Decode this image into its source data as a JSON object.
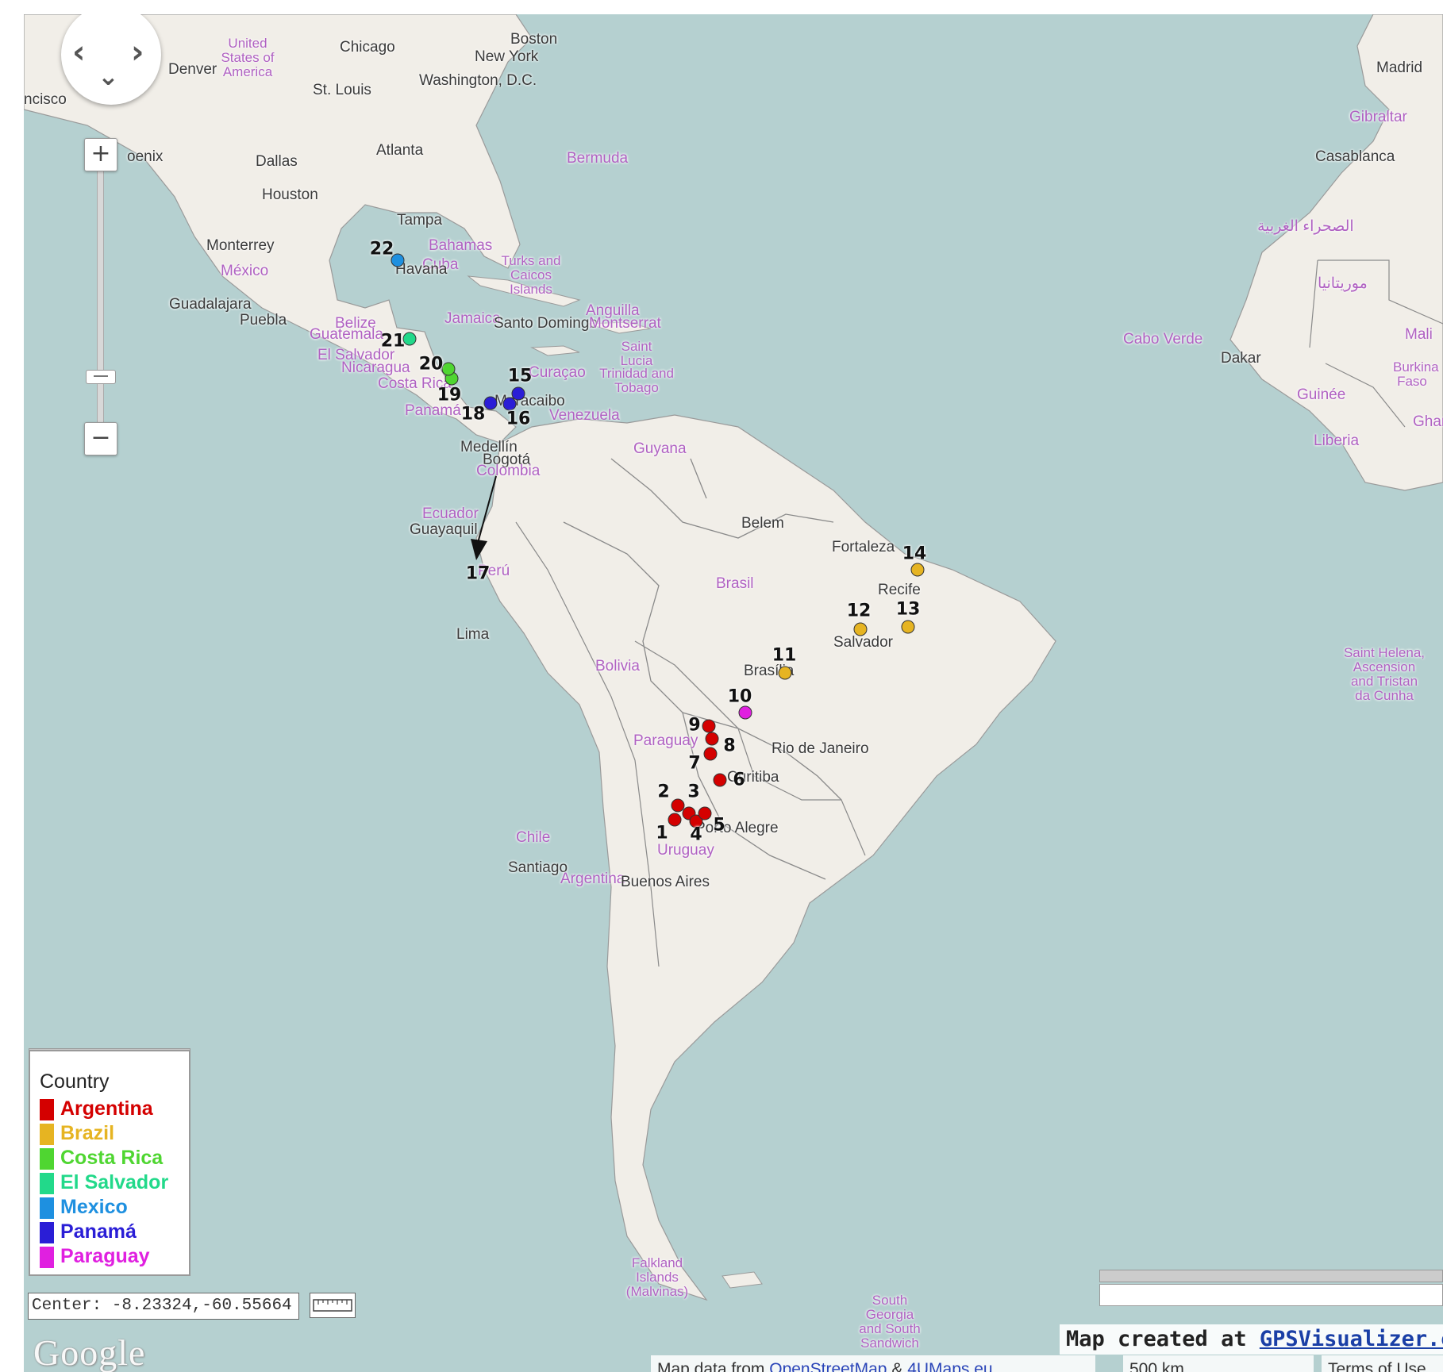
{
  "colors": {
    "water": "#b5d0d0",
    "land": "#f1eee8",
    "border": "#8a8a8a",
    "Argentina": "#d40000",
    "Brazil": "#e6b422",
    "Costa Rica": "#4fd631",
    "El Salvador": "#22d98a",
    "Mexico": "#1e90e0",
    "Panamá": "#2a1ed6",
    "Paraguay": "#e020e0"
  },
  "places": [
    {
      "name": "Chicago",
      "style": "dark"
    },
    {
      "name": "Boston",
      "style": "dark"
    },
    {
      "name": "New York",
      "style": "dark"
    },
    {
      "name": "Washington, D.C.",
      "style": "dark"
    },
    {
      "name": "St. Louis",
      "style": "dark"
    },
    {
      "name": "Denver",
      "style": "dark"
    },
    {
      "name": "United States of America",
      "style": "pink"
    },
    {
      "name": "ncisco",
      "style": "dark"
    },
    {
      "name": "oenix",
      "style": "dark"
    },
    {
      "name": "Dallas",
      "style": "dark"
    },
    {
      "name": "Atlanta",
      "style": "dark"
    },
    {
      "name": "Houston",
      "style": "dark"
    },
    {
      "name": "Tampa",
      "style": "dark"
    },
    {
      "name": "Bahamas",
      "style": "pink"
    },
    {
      "name": "Cuba",
      "style": "pink"
    },
    {
      "name": "Havana",
      "style": "dark"
    },
    {
      "name": "Bermuda",
      "style": "pink"
    },
    {
      "name": "Monterrey",
      "style": "dark"
    },
    {
      "name": "México",
      "style": "pink"
    },
    {
      "name": "Guadalajara",
      "style": "dark"
    },
    {
      "name": "Puebla",
      "style": "dark"
    },
    {
      "name": "Turks and Caicos Islands",
      "style": "pink"
    },
    {
      "name": "Jamaica",
      "style": "pink"
    },
    {
      "name": "Santo Domingo",
      "style": "dark"
    },
    {
      "name": "Anguilla",
      "style": "pink"
    },
    {
      "name": "Montserrat",
      "style": "pink"
    },
    {
      "name": "Belize",
      "style": "pink"
    },
    {
      "name": "Guatemala",
      "style": "pink"
    },
    {
      "name": "El Salvador",
      "style": "pink"
    },
    {
      "name": "Nicaragua",
      "style": "pink"
    },
    {
      "name": "Costa Rica",
      "style": "pink"
    },
    {
      "name": "Panamá",
      "style": "pink"
    },
    {
      "name": "Saint Lucia",
      "style": "pink"
    },
    {
      "name": "Curaçao",
      "style": "pink"
    },
    {
      "name": "Trinidad and Tobago",
      "style": "pink"
    },
    {
      "name": "Maracaibo",
      "style": "dark"
    },
    {
      "name": "Venezuela",
      "style": "pink"
    },
    {
      "name": "Medellín",
      "style": "dark"
    },
    {
      "name": "Bogotá",
      "style": "dark"
    },
    {
      "name": "Colombia",
      "style": "pink"
    },
    {
      "name": "Guyana",
      "style": "pink"
    },
    {
      "name": "Ecuador",
      "style": "pink"
    },
    {
      "name": "Guayaquil",
      "style": "dark"
    },
    {
      "name": "Perú",
      "style": "pink"
    },
    {
      "name": "Lima",
      "style": "dark"
    },
    {
      "name": "Belem",
      "style": "dark"
    },
    {
      "name": "Fortaleza",
      "style": "dark"
    },
    {
      "name": "Recife",
      "style": "dark"
    },
    {
      "name": "Brasil",
      "style": "pink"
    },
    {
      "name": "Salvador",
      "style": "dark"
    },
    {
      "name": "Brasília",
      "style": "dark"
    },
    {
      "name": "Bolivia",
      "style": "pink"
    },
    {
      "name": "Paraguay",
      "style": "pink"
    },
    {
      "name": "Rio de Janeiro",
      "style": "dark"
    },
    {
      "name": "Curitiba",
      "style": "dark"
    },
    {
      "name": "Porto Alegre",
      "style": "dark"
    },
    {
      "name": "Chile",
      "style": "pink"
    },
    {
      "name": "Uruguay",
      "style": "pink"
    },
    {
      "name": "Santiago",
      "style": "dark"
    },
    {
      "name": "Argentina",
      "style": "pink"
    },
    {
      "name": "Buenos Aires",
      "style": "dark"
    },
    {
      "name": "Falkland Islands (Malvinas)",
      "style": "pink"
    },
    {
      "name": "South Georgia and South Sandwich",
      "style": "pink"
    },
    {
      "name": "Madrid",
      "style": "dark"
    },
    {
      "name": "Gibraltar",
      "style": "pink"
    },
    {
      "name": "Casablanca",
      "style": "dark"
    },
    {
      "name": "الصحراء الغربية",
      "style": "pink"
    },
    {
      "name": "موريتانيا",
      "style": "pink"
    },
    {
      "name": "Cabo Verde",
      "style": "pink"
    },
    {
      "name": "Dakar",
      "style": "dark"
    },
    {
      "name": "Mali",
      "style": "pink"
    },
    {
      "name": "Burkina Faso",
      "style": "pink"
    },
    {
      "name": "Guinée",
      "style": "pink"
    },
    {
      "name": "Ghana",
      "style": "pink"
    },
    {
      "name": "Liberia",
      "style": "pink"
    },
    {
      "name": "Saint Helena, Ascension and Tristan da Cunha",
      "style": "pink"
    }
  ],
  "markers": [
    {
      "label": "1",
      "country": "Argentina"
    },
    {
      "label": "2",
      "country": "Argentina"
    },
    {
      "label": "3",
      "country": "Argentina"
    },
    {
      "label": "4",
      "country": "Argentina"
    },
    {
      "label": "5",
      "country": "Argentina"
    },
    {
      "label": "6",
      "country": "Argentina"
    },
    {
      "label": "7",
      "country": "Argentina"
    },
    {
      "label": "8",
      "country": "Argentina"
    },
    {
      "label": "9",
      "country": "Argentina"
    },
    {
      "label": "10",
      "country": "Paraguay"
    },
    {
      "label": "11",
      "country": "Brazil"
    },
    {
      "label": "12",
      "country": "Brazil"
    },
    {
      "label": "13",
      "country": "Brazil"
    },
    {
      "label": "14",
      "country": "Brazil"
    },
    {
      "label": "15",
      "country": "Panamá"
    },
    {
      "label": "16",
      "country": "Panamá"
    },
    {
      "label": "17",
      "country": "Panamá"
    },
    {
      "label": "18",
      "country": "Panamá"
    },
    {
      "label": "19",
      "country": "Costa Rica"
    },
    {
      "label": "20",
      "country": "Costa Rica"
    },
    {
      "label": "21",
      "country": "El Salvador"
    },
    {
      "label": "22",
      "country": "Mexico"
    }
  ],
  "legend": {
    "title": "Country",
    "items": [
      "Argentina",
      "Brazil",
      "Costa Rica",
      "El Salvador",
      "Mexico",
      "Panamá",
      "Paraguay"
    ]
  },
  "center_readout": "Center: -8.23324,-60.55664",
  "logo": "Google",
  "credit_prefix": "Map created at ",
  "credit_link": "GPSVisualizer.com",
  "map_data_prefix": "Map data from ",
  "map_data_osm": "OpenStreetMap",
  "map_data_amp": " & ",
  "map_data_4u": "4UMaps.eu",
  "scale_label": "500 km",
  "terms": "Terms of Use",
  "nav": {
    "zoom_in": "+",
    "zoom_out": "−"
  }
}
